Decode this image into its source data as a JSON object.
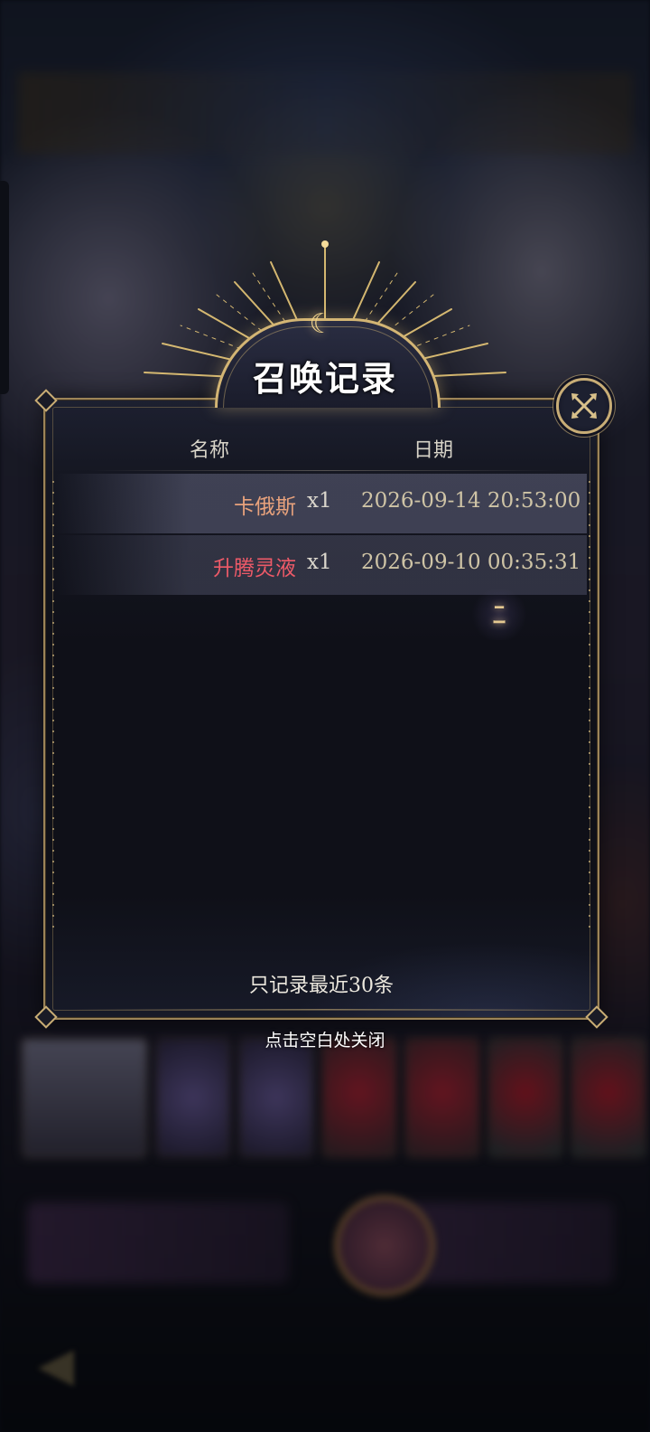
{
  "dialog": {
    "title": "召唤记录",
    "close_icon": "close-x-icon",
    "columns": {
      "name": "名称",
      "date": "日期"
    },
    "records": [
      {
        "name": "卡俄斯",
        "qty": "x1",
        "date": "2026-09-14 20:53:00",
        "name_color": "#e8a27c"
      },
      {
        "name": "升腾灵液",
        "qty": "x1",
        "date": "2026-09-10 00:35:31",
        "name_color": "#ee5a68"
      }
    ],
    "note": "只记录最近30条",
    "dismiss_hint": "点击空白处关闭"
  },
  "colors": {
    "frame_gold": "#c8ad76",
    "panel_bg": "#0f1018",
    "row_bg": "#46485c"
  },
  "icons": {
    "title_emblem": "crescent-moon-icon",
    "decoration": "sparkle-z-icon",
    "background_back": "back-arrow-icon"
  }
}
